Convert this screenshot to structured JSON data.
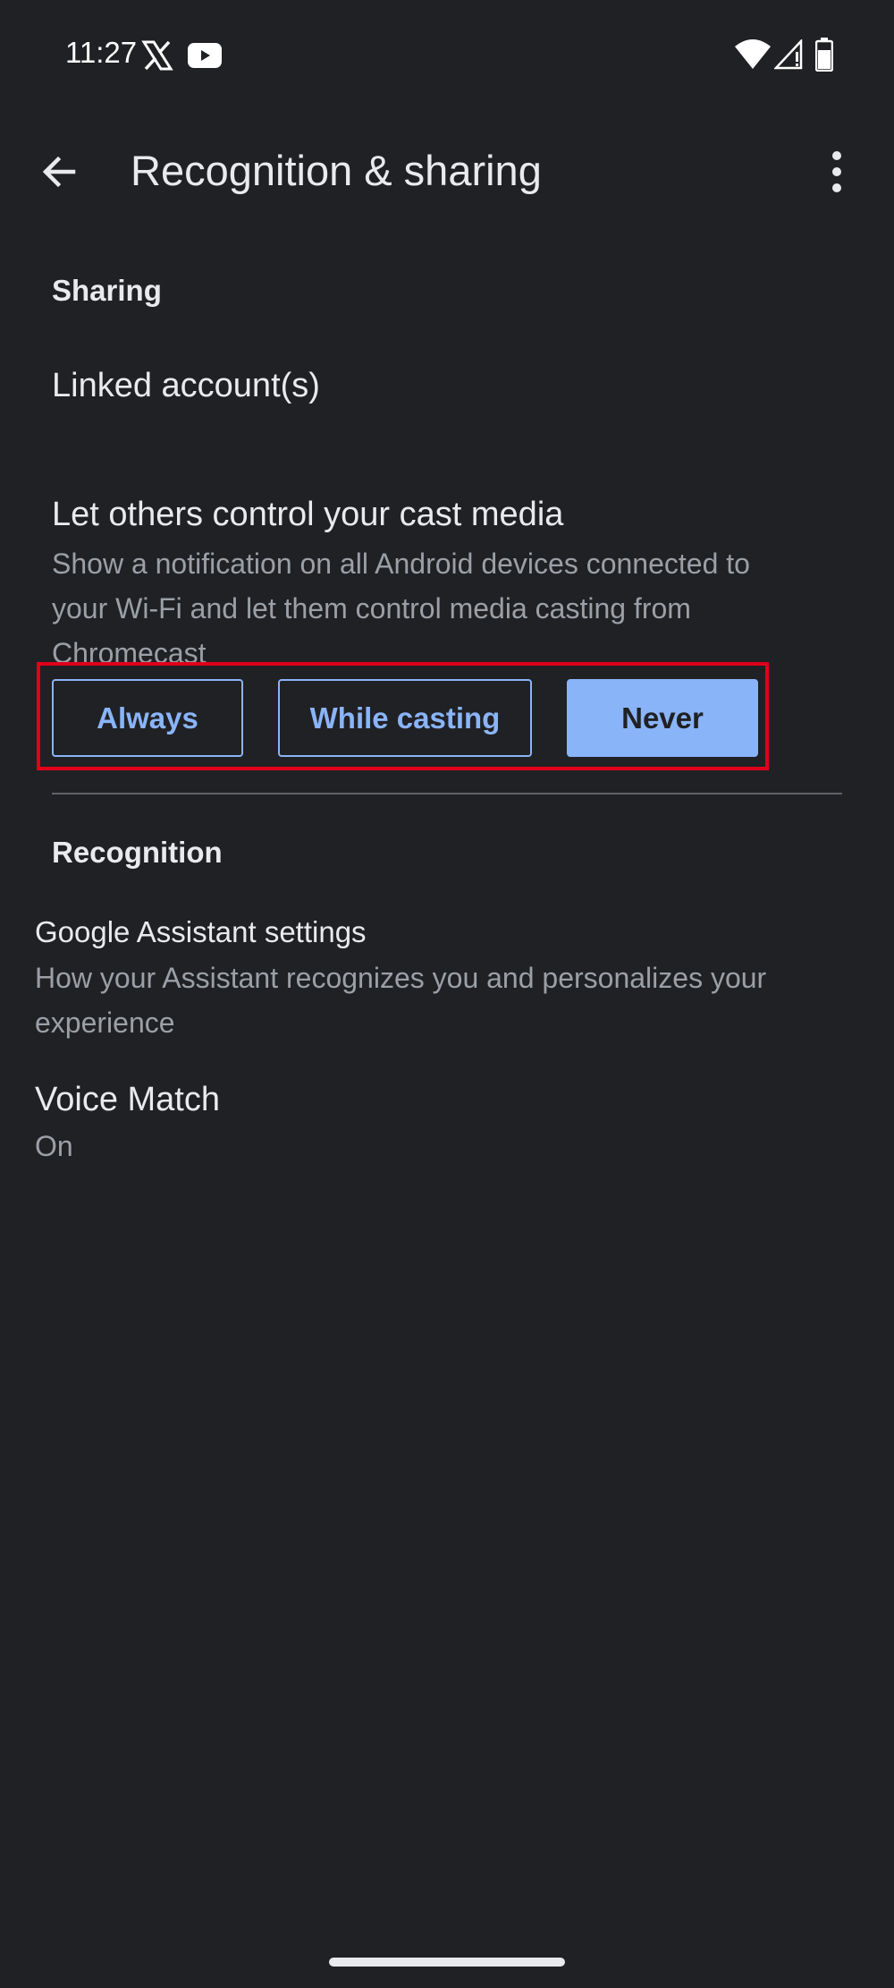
{
  "status_bar": {
    "time": "11:27",
    "icons": [
      "x-logo-icon",
      "youtube-icon",
      "wifi-icon",
      "signal-icon",
      "battery-icon"
    ]
  },
  "app_bar": {
    "title": "Recognition & sharing",
    "back_icon": "arrow-back-icon",
    "menu_icon": "more-vert-icon"
  },
  "sharing": {
    "header": "Sharing",
    "linked_accounts": "Linked account(s)",
    "cast_control": {
      "title": "Let others control your cast media",
      "description": "Show a notification on all Android devices connected to your Wi-Fi and let them control media casting from Chromecast",
      "options": [
        "Always",
        "While casting",
        "Never"
      ],
      "selected": "Never"
    }
  },
  "recognition": {
    "header": "Recognition",
    "assistant_settings": {
      "title": "Google Assistant settings",
      "description": "How your Assistant recognizes you and personalizes your experience"
    },
    "voice_match": {
      "title": "Voice Match",
      "value": "On"
    }
  },
  "colors": {
    "background": "#202124",
    "accent": "#8ab4f8",
    "highlight": "#e0001b",
    "secondary_text": "#9aa0a6"
  }
}
